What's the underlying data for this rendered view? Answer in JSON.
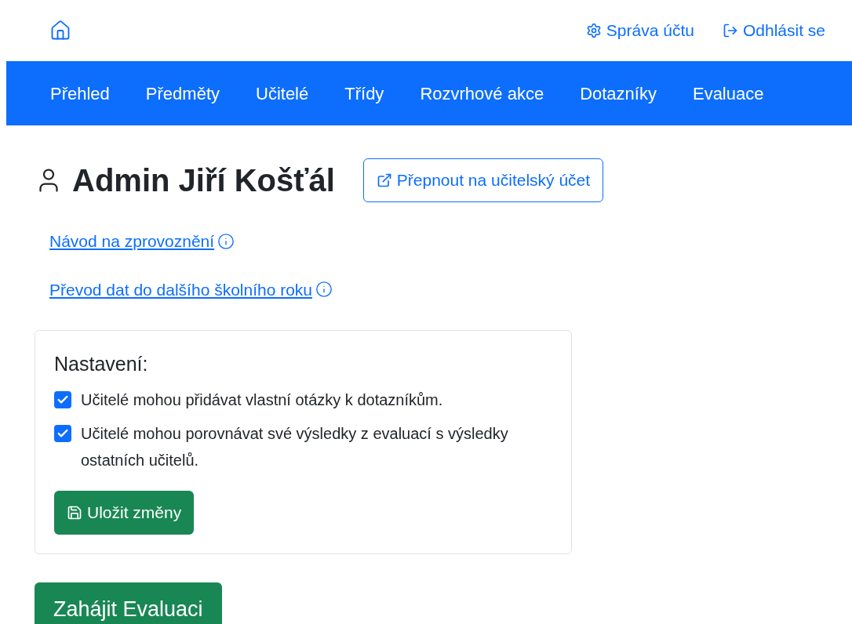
{
  "header": {
    "links": [
      {
        "kind": "settings",
        "label": "Správa účtu"
      },
      {
        "kind": "logout",
        "label": "Odhlásit se"
      }
    ]
  },
  "nav": [
    {
      "label": "Přehled"
    },
    {
      "label": "Předměty"
    },
    {
      "label": "Učitelé"
    },
    {
      "label": "Třídy"
    },
    {
      "label": "Rozvrhové akce"
    },
    {
      "label": "Dotazníky"
    },
    {
      "label": "Evaluace"
    }
  ],
  "user": {
    "name": "Admin Jiří Košťál",
    "switch_button": "Přepnout na učitelský účet"
  },
  "help_links": [
    "Návod na zprovoznění",
    "Převod dat do dalšího školního roku"
  ],
  "settings": {
    "title": "Nastavení:",
    "options": [
      {
        "label": "Učitelé mohou přidávat vlastní otázky k dotazníkům.",
        "checked": true
      },
      {
        "label": "Učitelé mohou porovnávat své výsledky z evaluací s výsledky ostatních učitelů.",
        "checked": true
      }
    ],
    "save_button": "Uložit změny"
  },
  "start_button": "Zahájit Evaluaci"
}
